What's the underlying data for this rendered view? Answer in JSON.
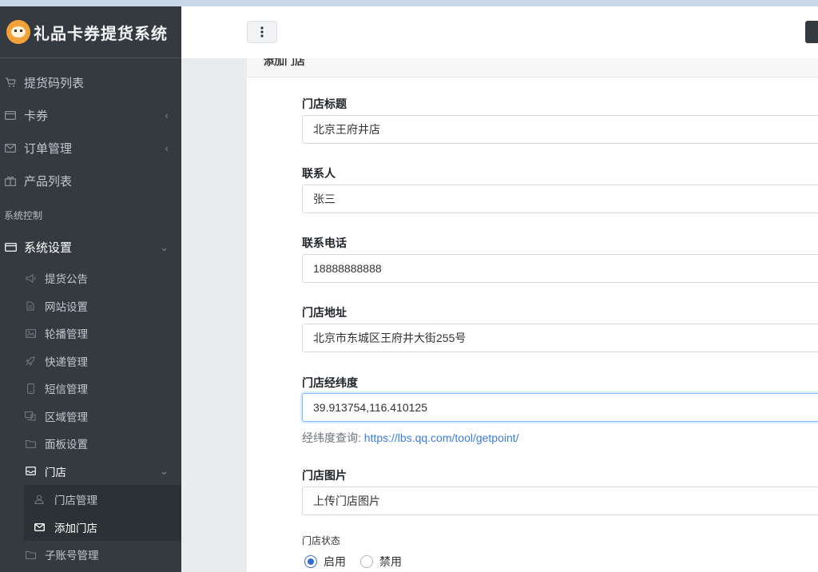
{
  "app": {
    "title": "礼品卡券提货系统"
  },
  "sidebar": {
    "items": [
      {
        "label": "提货码列表",
        "icon": "cart-icon"
      },
      {
        "label": "卡券",
        "icon": "card-icon"
      },
      {
        "label": "订单管理",
        "icon": "envelope-icon"
      },
      {
        "label": "产品列表",
        "icon": "gift-icon"
      }
    ],
    "section_header": "系统控制",
    "settings": {
      "label": "系统设置",
      "icon": "card-icon"
    },
    "settings_children": [
      {
        "label": "提货公告",
        "icon": "megaphone-icon"
      },
      {
        "label": "网站设置",
        "icon": "file-icon"
      },
      {
        "label": "轮播管理",
        "icon": "image-icon"
      },
      {
        "label": "快递管理",
        "icon": "rocket-icon"
      },
      {
        "label": "短信管理",
        "icon": "mobile-icon"
      },
      {
        "label": "区域管理",
        "icon": "desktop-icon"
      },
      {
        "label": "面板设置",
        "icon": "folder-icon"
      }
    ],
    "store": {
      "label": "门店",
      "icon": "inbox-icon"
    },
    "store_children": [
      {
        "label": "门店管理",
        "icon": "user-icon"
      },
      {
        "label": "添加门店",
        "icon": "envelope-icon"
      }
    ],
    "subaccount": {
      "label": "子账号管理",
      "icon": "folder-icon"
    }
  },
  "card": {
    "title": "添加门店"
  },
  "form": {
    "store_title": {
      "label": "门店标题",
      "value": "北京王府井店"
    },
    "contact": {
      "label": "联系人",
      "value": "张三"
    },
    "phone": {
      "label": "联系电话",
      "value": "18888888888"
    },
    "address": {
      "label": "门店地址",
      "value": "北京市东城区王府井大街255号"
    },
    "coords": {
      "label": "门店经纬度",
      "value": "39.913754,116.410125"
    },
    "coords_help": {
      "prefix": "经纬度查询:",
      "link": "https://lbs.qq.com/tool/getpoint/"
    },
    "image": {
      "label": "门店图片",
      "button": "上传门店图片"
    },
    "status": {
      "label": "门店状态",
      "enabled": "启用",
      "disabled": "禁用",
      "selected": "启用"
    }
  },
  "colors": {
    "sidebar_bg": "#343a40",
    "accent": "#2f6fd1",
    "link": "#3b7ddd"
  }
}
